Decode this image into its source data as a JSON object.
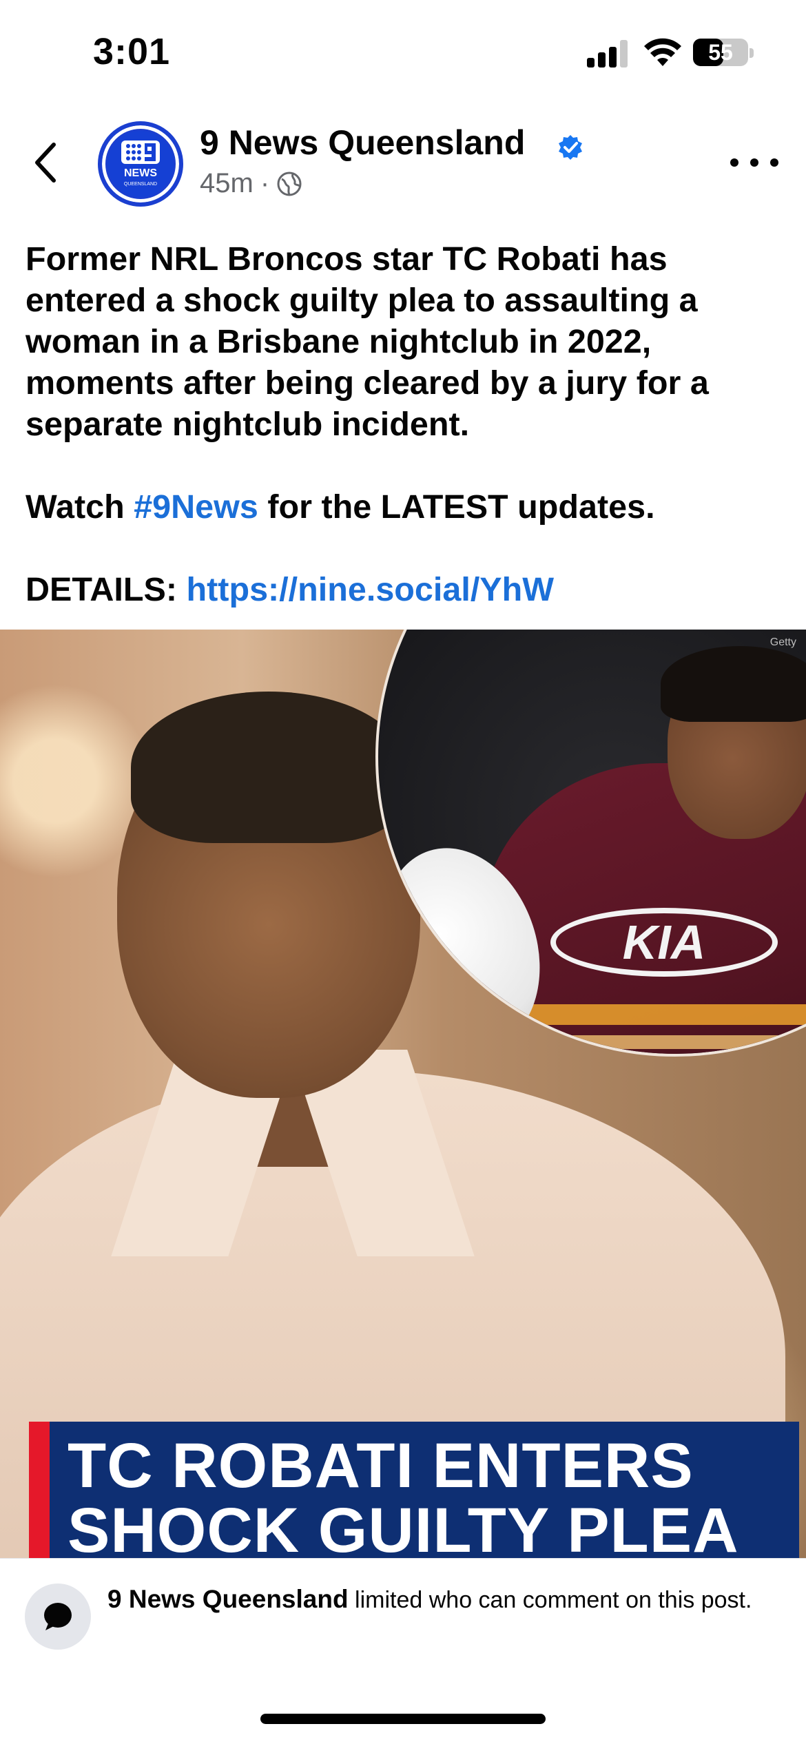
{
  "status_bar": {
    "time": "3:01",
    "battery": "55",
    "battery_level_percent": 55
  },
  "header": {
    "back_icon": "chevron-left-icon",
    "page_name": "9 News Queensland",
    "verified_icon": "verified-badge-icon",
    "time_ago": "45m",
    "separator": "·",
    "audience_icon": "globe-icon",
    "more_icon": "ellipsis-icon",
    "avatar_logo_text": "9 NEWS QUEENSLAND"
  },
  "post": {
    "paragraph1": "Former NRL Broncos star TC Robati has entered a shock guilty plea to assaulting a woman in a Brisbane nightclub in 2022, moments after being cleared by a jury for a separate nightclub incident.",
    "watch_prefix": "Watch",
    "hashtag": "#9News",
    "watch_suffix": "for the LATEST updates.",
    "details_prefix": "DETAILS:",
    "details_link": "https://nine.social/YhW",
    "link_color": "#1b6fd8"
  },
  "image": {
    "credit": "Getty",
    "headline_line1": "TC ROBATI ENTERS",
    "headline_line2": "SHOCK GUILTY PLEA",
    "jersey_sponsor": "KIA",
    "banner_color": "#0e2f73",
    "accent_color": "#e5182a"
  },
  "comment_notice": {
    "icon": "comment-bubble-icon",
    "page_name": "9 News Queensland",
    "message": "limited who can comment on this post."
  }
}
